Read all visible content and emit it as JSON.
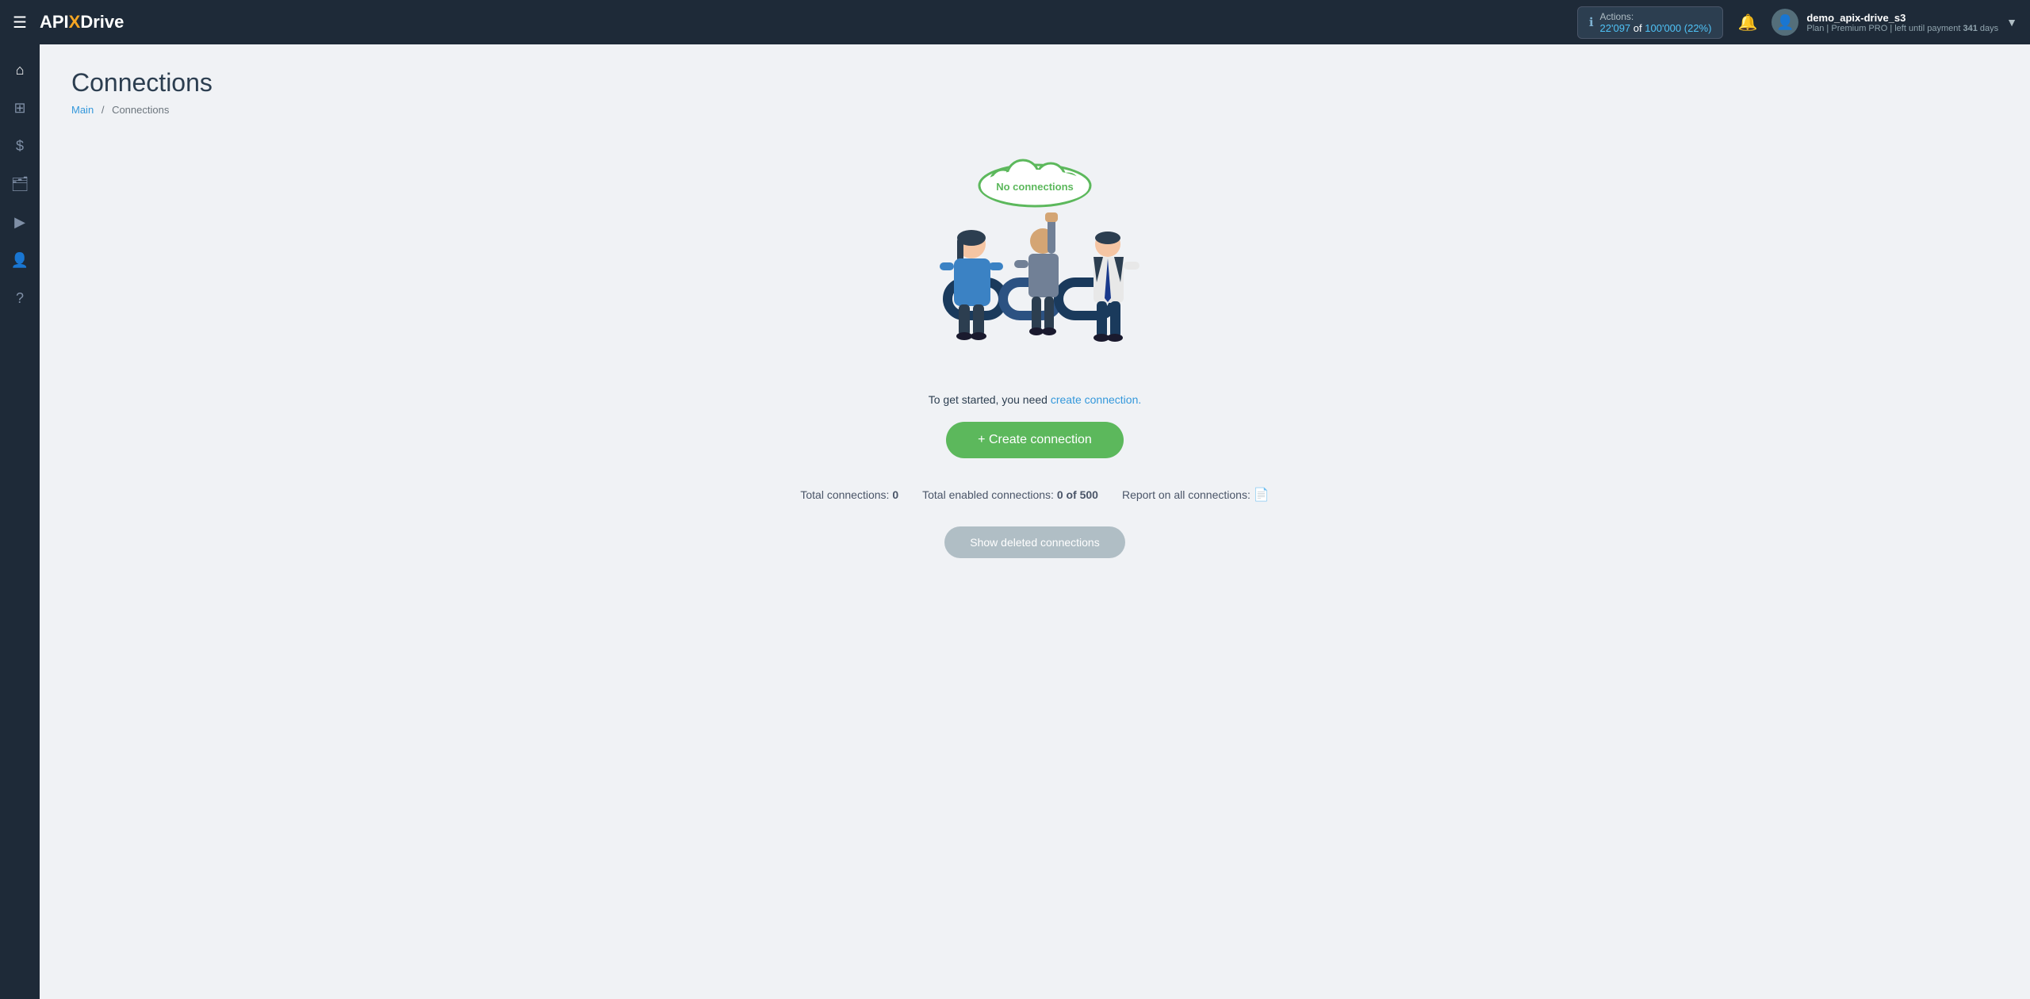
{
  "topnav": {
    "logo": {
      "api": "API",
      "x": "X",
      "drive": "Drive"
    },
    "actions": {
      "label": "Actions:",
      "used": "22'097",
      "of_text": "of",
      "total": "100'000",
      "percent": "(22%)"
    },
    "user": {
      "name": "demo_apix-drive_s3",
      "plan_prefix": "Plan |",
      "plan_name": "Premium PRO",
      "plan_suffix": "| left until payment",
      "days": "341",
      "days_suffix": "days"
    }
  },
  "sidebar": {
    "items": [
      {
        "id": "home",
        "icon": "⌂",
        "label": "Home"
      },
      {
        "id": "connections",
        "icon": "⊞",
        "label": "Connections"
      },
      {
        "id": "billing",
        "icon": "$",
        "label": "Billing"
      },
      {
        "id": "briefcase",
        "icon": "✎",
        "label": "Projects"
      },
      {
        "id": "video",
        "icon": "▶",
        "label": "Video"
      },
      {
        "id": "profile",
        "icon": "👤",
        "label": "Profile"
      },
      {
        "id": "help",
        "icon": "?",
        "label": "Help"
      }
    ]
  },
  "page": {
    "title": "Connections",
    "breadcrumb_main": "Main",
    "breadcrumb_current": "Connections"
  },
  "empty_state": {
    "cloud_text": "No connections",
    "description_prefix": "To get started, you need",
    "description_link": "create connection.",
    "create_button": "+ Create connection",
    "stats": {
      "total_label": "Total connections:",
      "total_value": "0",
      "enabled_label": "Total enabled connections:",
      "enabled_value": "0 of 500",
      "report_label": "Report on all connections:"
    },
    "show_deleted": "Show deleted connections"
  }
}
